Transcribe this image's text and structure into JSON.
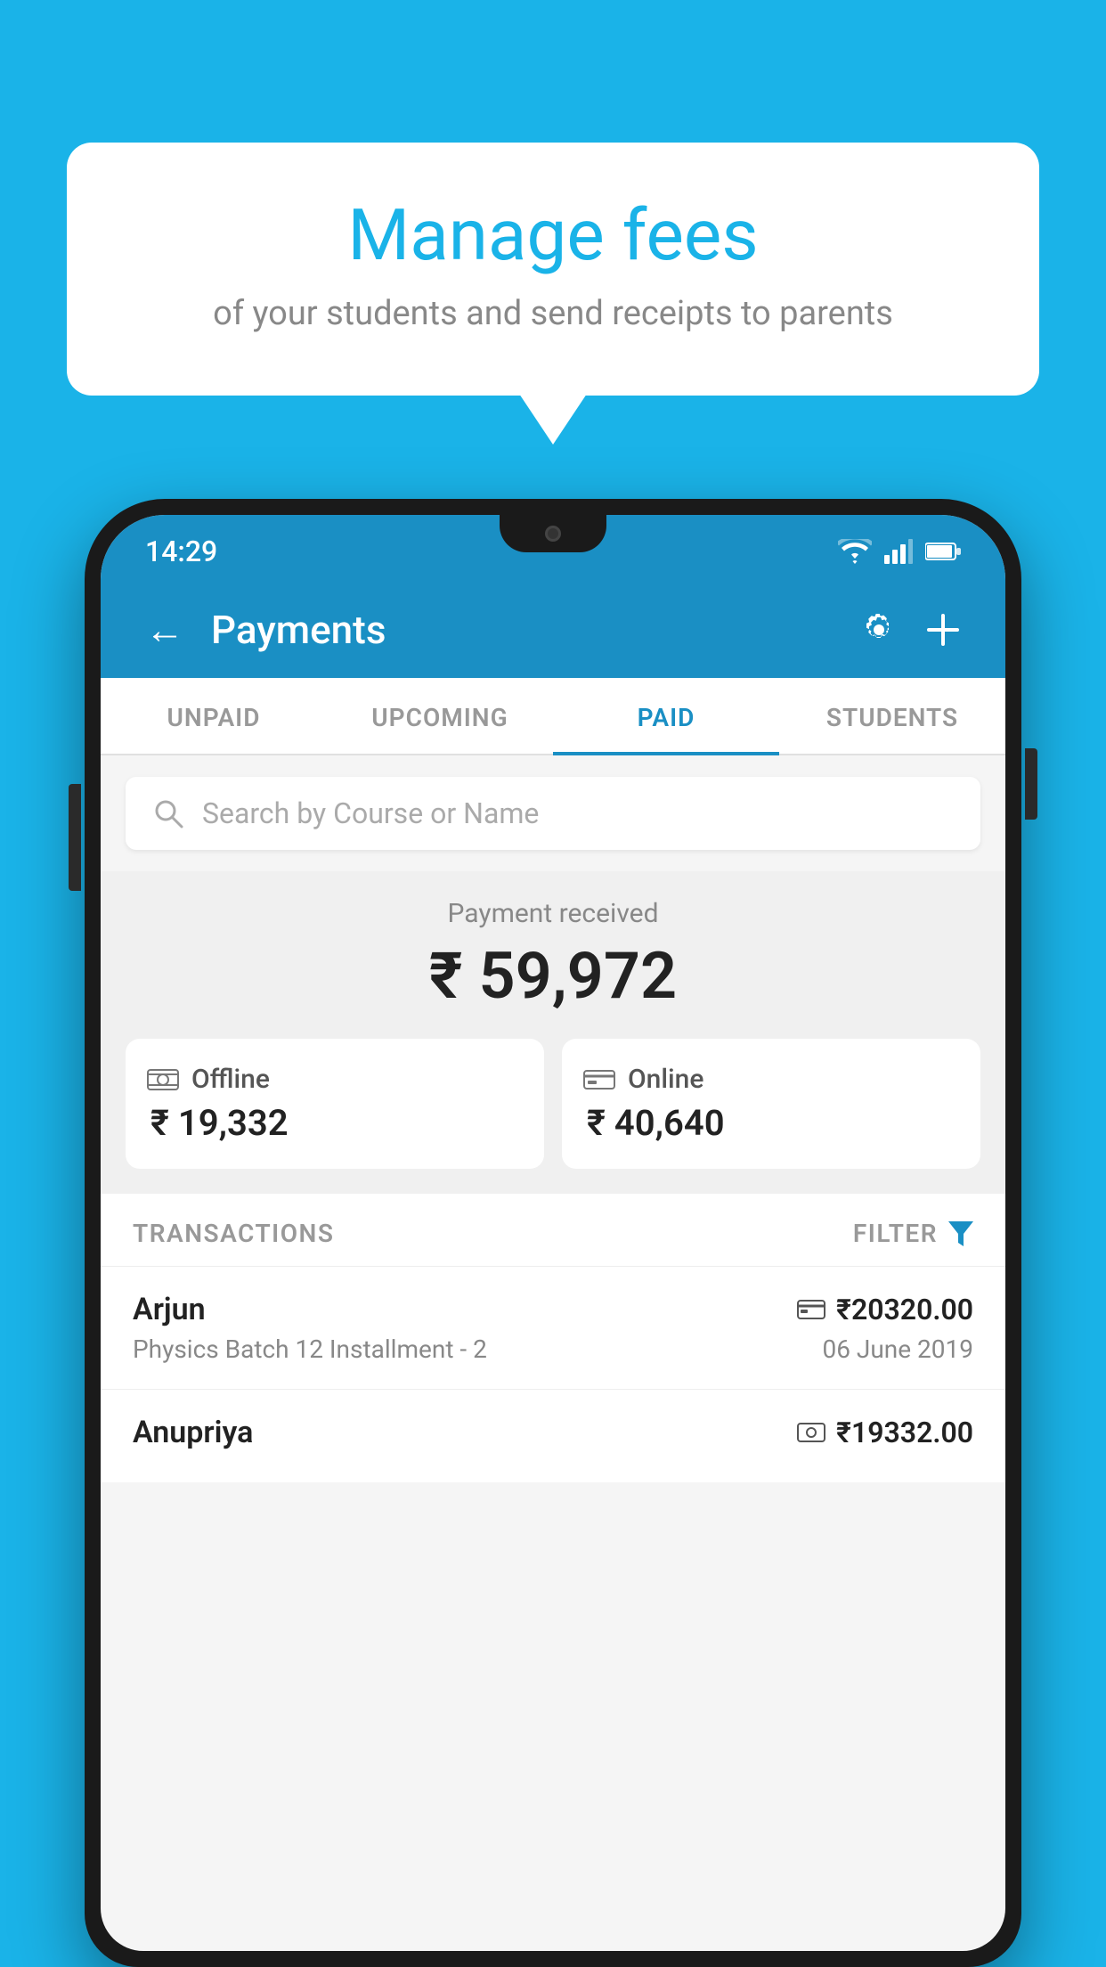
{
  "background_color": "#1ab3e8",
  "speech_bubble": {
    "title": "Manage fees",
    "subtitle": "of your students and send receipts to parents"
  },
  "status_bar": {
    "time": "14:29",
    "wifi": "wifi-icon",
    "signal": "signal-icon",
    "battery": "battery-icon"
  },
  "app_header": {
    "back_label": "←",
    "title": "Payments",
    "settings_icon": "gear-icon",
    "add_icon": "plus-icon"
  },
  "tabs": [
    {
      "label": "UNPAID",
      "active": false
    },
    {
      "label": "UPCOMING",
      "active": false
    },
    {
      "label": "PAID",
      "active": true
    },
    {
      "label": "STUDENTS",
      "active": false
    }
  ],
  "search": {
    "placeholder": "Search by Course or Name"
  },
  "payment_received": {
    "label": "Payment received",
    "total": "₹ 59,972",
    "offline": {
      "type": "Offline",
      "amount": "₹ 19,332"
    },
    "online": {
      "type": "Online",
      "amount": "₹ 40,640"
    }
  },
  "transactions_header": {
    "label": "TRANSACTIONS",
    "filter_label": "FILTER"
  },
  "transactions": [
    {
      "name": "Arjun",
      "amount": "₹20320.00",
      "payment_type": "card",
      "course": "Physics Batch 12 Installment - 2",
      "date": "06 June 2019"
    },
    {
      "name": "Anupriya",
      "amount": "₹19332.00",
      "payment_type": "cash",
      "course": "",
      "date": ""
    }
  ]
}
